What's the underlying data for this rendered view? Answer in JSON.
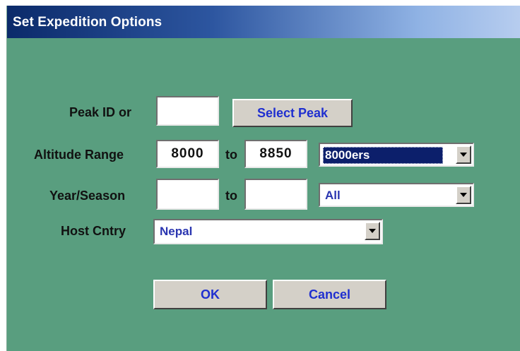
{
  "window": {
    "title": "Set Expedition Options"
  },
  "peak": {
    "label": "Peak ID or",
    "value": "",
    "select_button": "Select Peak"
  },
  "altitude": {
    "label": "Altitude Range",
    "from": "8000",
    "to_label": "to",
    "to": "8850",
    "preset": "8000ers"
  },
  "year_season": {
    "label": "Year/Season",
    "from": "",
    "to_label": "to",
    "to": "",
    "season": "All"
  },
  "host_country": {
    "label": "Host Cntry",
    "value": "Nepal"
  },
  "buttons": {
    "ok": "OK",
    "cancel": "Cancel"
  },
  "colors": {
    "background": "#599e7f",
    "title_start": "#0b2a6a",
    "title_end": "#b7cdef",
    "accent_text": "#1f2fd0"
  },
  "icons": {
    "dropdown": "chevron-down-icon"
  }
}
